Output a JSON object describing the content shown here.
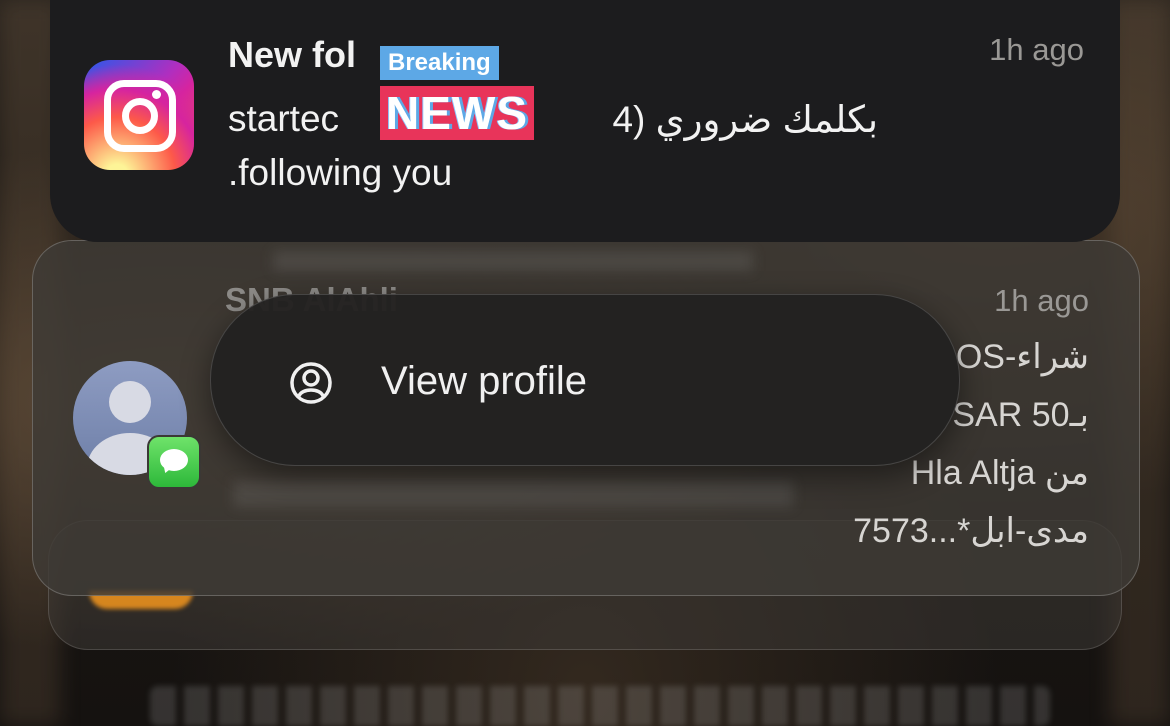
{
  "instagram_notification": {
    "app_icon": "instagram-app-icon",
    "title": "New fol",
    "time": "1h ago",
    "body_line1_start": "startec",
    "body_line1_arabic": "بكلمك ضروري (4",
    "body_line2": ".following you"
  },
  "overlay": {
    "breaking": "Breaking",
    "news": "NEWS"
  },
  "sms_notification": {
    "sender": "SNB AlAhli",
    "time": "1h ago",
    "lines": [
      "شراء-OS",
      "بـ50 SAR",
      "من Hla Altja",
      "مدى-ابل*...7573"
    ],
    "avatar": "person-avatar",
    "badge_icon": "messages-icon"
  },
  "context_menu": {
    "items": [
      {
        "label": "View profile",
        "icon": "person-circle-icon"
      }
    ]
  },
  "colors": {
    "breaking_bg": "#5da8e6",
    "news_bg": "#e8345a",
    "messages_green": "#2db83a"
  }
}
